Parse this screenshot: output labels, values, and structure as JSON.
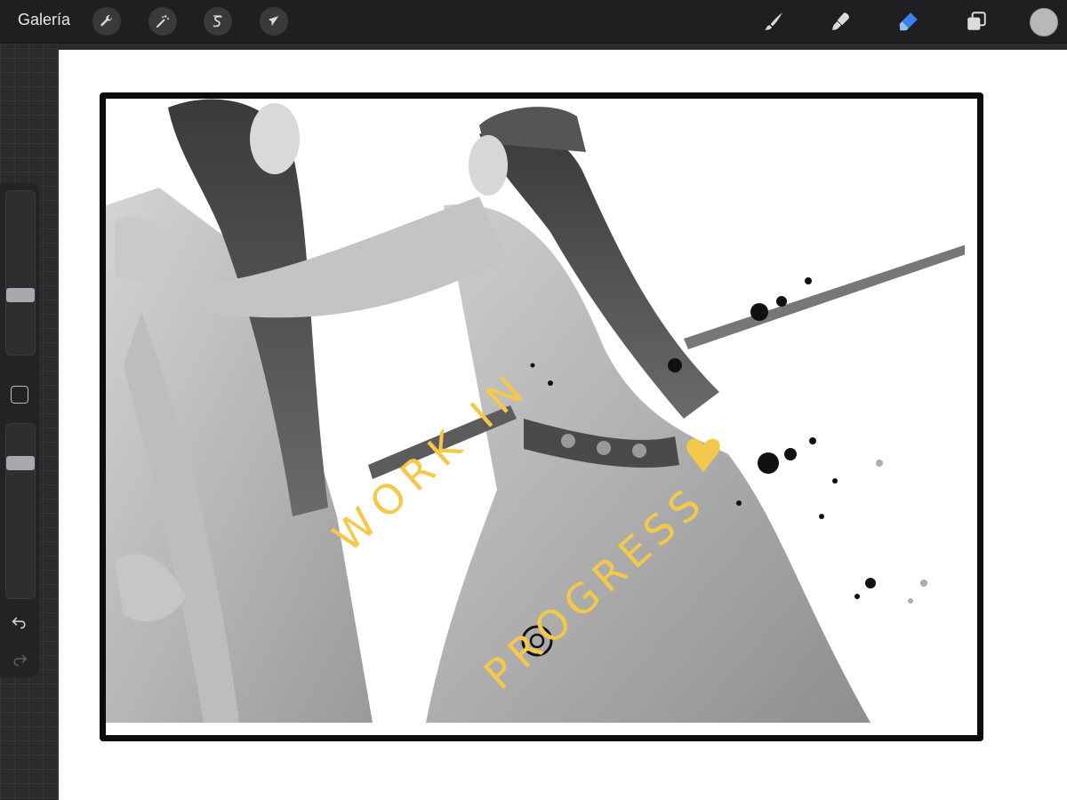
{
  "toolbar": {
    "gallery_label": "Galería",
    "left_tools": [
      {
        "name": "actions",
        "icon": "wrench-icon"
      },
      {
        "name": "adjustments",
        "icon": "magic-wand-icon"
      },
      {
        "name": "selection",
        "icon": "selection-s-icon"
      },
      {
        "name": "transform",
        "icon": "arrow-cursor-icon"
      }
    ],
    "right_tools": [
      {
        "name": "brush",
        "icon": "brush-icon",
        "active": false
      },
      {
        "name": "smudge",
        "icon": "smudge-icon",
        "active": false
      },
      {
        "name": "eraser",
        "icon": "eraser-icon",
        "active": true
      },
      {
        "name": "layers",
        "icon": "layers-icon",
        "active": false
      }
    ],
    "current_color": "#b8b8bb",
    "accent_color": "#3b82f6"
  },
  "sidebar": {
    "brush_size_level": 0.35,
    "opacity_level": 0.8,
    "undo_icon": "undo-icon",
    "redo_icon": "redo-icon"
  },
  "canvas": {
    "watermark_line1": "WORK IN",
    "watermark_line2": "PROGRESS",
    "watermark_color": "#f4c84a"
  }
}
